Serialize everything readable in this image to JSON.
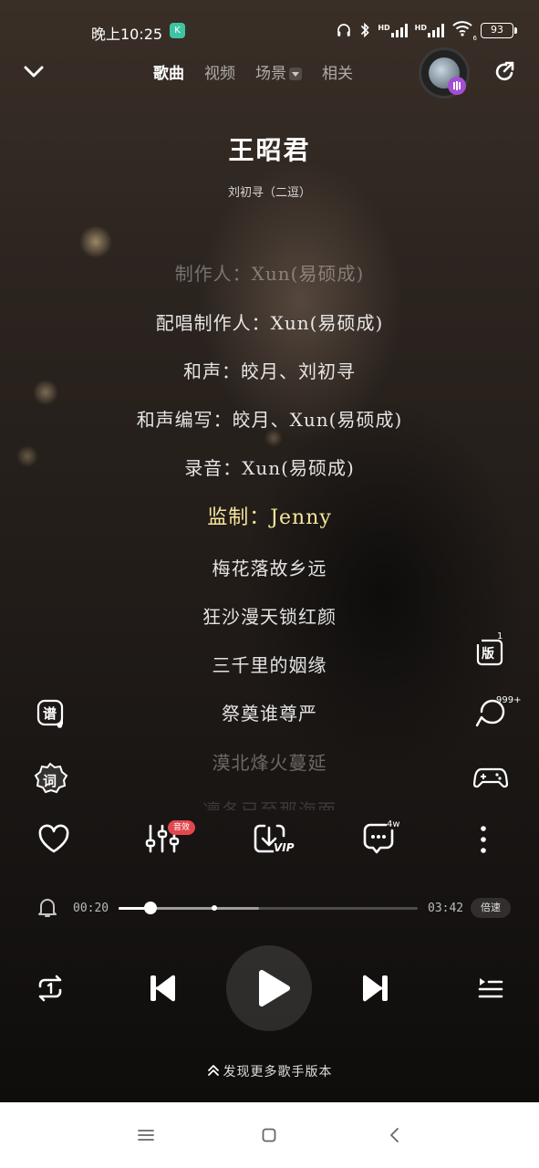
{
  "status_bar": {
    "time": "晚上10:25",
    "app_icon": "K",
    "hd1": "HD",
    "hd2": "HD",
    "wifi_sub": "6",
    "battery": "93"
  },
  "nav": {
    "tabs": [
      {
        "label": "歌曲",
        "active": true
      },
      {
        "label": "视频",
        "active": false
      },
      {
        "label": "场景",
        "active": false
      },
      {
        "label": "相关",
        "active": false
      }
    ]
  },
  "song": {
    "title": "王昭君",
    "artist": "刘初寻（二逗）"
  },
  "lyrics": [
    "制作人：Xun(易硕成)",
    "配唱制作人：Xun(易硕成)",
    "和声：皎月、刘初寻",
    "和声编写：皎月、Xun(易硕成)",
    "录音：Xun(易硕成)",
    "监制：Jenny",
    "梅花落故乡远",
    "狂沙漫天锁红颜",
    "三千里的姻缘",
    "祭奠谁尊严",
    "漠北烽火蔓延",
    "凛冬已至那海面"
  ],
  "current_lyric_index": 5,
  "side": {
    "sheet_label": "谱",
    "lyrics_label": "词",
    "version_label": "版",
    "version_count": "1",
    "comments_count": "999+"
  },
  "actions": {
    "effect_badge": "音效",
    "download_vip": "VIP",
    "comment_count": "4w"
  },
  "progress": {
    "current": "00:20",
    "total": "03:42",
    "played_fraction": 0.108,
    "buffered_fraction": 0.47,
    "highlight_fraction": 0.32,
    "speed_label": "倍速"
  },
  "footer": {
    "more_versions": "发现更多歌手版本"
  },
  "colors": {
    "current_lyric": "#f5e59a",
    "badge_red": "#e2474d",
    "vip_purple": "#a34fd1"
  }
}
